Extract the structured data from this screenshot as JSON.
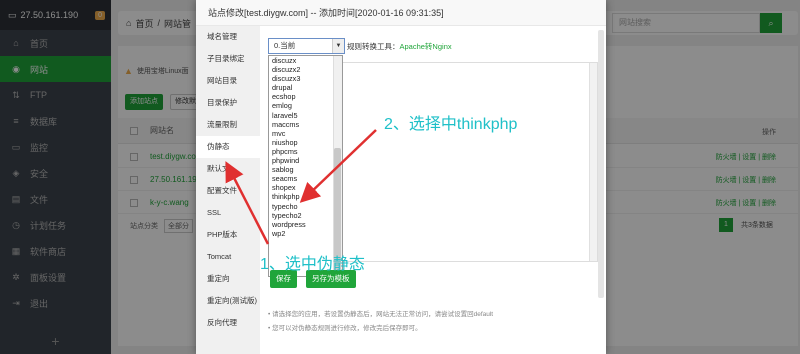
{
  "sidebar": {
    "server_ip": "27.50.161.190",
    "badge": "0",
    "items": [
      {
        "label": "首页",
        "icon": "home-icon",
        "glyph": "⌂"
      },
      {
        "label": "网站",
        "icon": "globe-icon",
        "glyph": "◉"
      },
      {
        "label": "FTP",
        "icon": "ftp-icon",
        "glyph": "⇅"
      },
      {
        "label": "数据库",
        "icon": "database-icon",
        "glyph": "≡"
      },
      {
        "label": "监控",
        "icon": "monitor-icon",
        "glyph": "▭"
      },
      {
        "label": "安全",
        "icon": "shield-icon",
        "glyph": "◈"
      },
      {
        "label": "文件",
        "icon": "folder-icon",
        "glyph": "▤"
      },
      {
        "label": "计划任务",
        "icon": "clock-icon",
        "glyph": "◷"
      },
      {
        "label": "软件商店",
        "icon": "grid-icon",
        "glyph": "▦"
      },
      {
        "label": "面板设置",
        "icon": "gear-icon",
        "glyph": "✲"
      },
      {
        "label": "退出",
        "icon": "logout-icon",
        "glyph": "⇥"
      }
    ],
    "add": "+"
  },
  "background": {
    "breadcrumb_home": "首页",
    "breadcrumb_current": "网站管",
    "search_placeholder": "网站搜索",
    "warning": "使用宝塔Linux面",
    "add_site": "添加站点",
    "modify": "修改默",
    "col_name": "网站名",
    "col_op": "操作",
    "rows": [
      {
        "name": "test.diygw.com",
        "actions": "防火墙 | 设置 | 删除"
      },
      {
        "name": "27.50.161.190",
        "actions": "防火墙 | 设置 | 删除"
      },
      {
        "name": "k-y-c.wang",
        "actions": "防火墙 | 设置 | 删除"
      }
    ],
    "site_category": "站点分类",
    "category_value": "全部分",
    "page": "1",
    "total": "共3条数据"
  },
  "modal": {
    "title": "站点修改[test.diygw.com] -- 添加时间[2020-01-16 09:31:35]",
    "nav": [
      "域名管理",
      "子目录绑定",
      "网站目录",
      "目录保护",
      "流量限制",
      "伪静态",
      "默认文",
      "配置文件",
      "SSL",
      "PHP版本",
      "Tomcat",
      "重定向",
      "重定向(测试版)",
      "反向代理"
    ],
    "dropdown_value": "0.当前",
    "convert_label": "规则转换工具：",
    "convert_link": "Apache转Nginx",
    "rewrite_options": [
      "discuzx",
      "discuzx2",
      "discuzx3",
      "drupal",
      "ecshop",
      "emlog",
      "laravel5",
      "maccms",
      "mvc",
      "niushop",
      "phpcms",
      "phpwind",
      "sablog",
      "seacms",
      "shopex",
      "thinkphp",
      "typecho",
      "typecho2",
      "wordpress",
      "wp2"
    ],
    "save": "保存",
    "save_template": "另存为模板",
    "tip1": "请选择您的应用，若设置伪静态后，网站无法正常访问，请尝试设置回default",
    "tip2": "您可以对伪静态规则进行修改，修改完后保存即可。"
  },
  "annotations": {
    "step1": "1、选中伪静态",
    "step2": "2、选择中thinkphp",
    "color": "#1fc0c8"
  }
}
